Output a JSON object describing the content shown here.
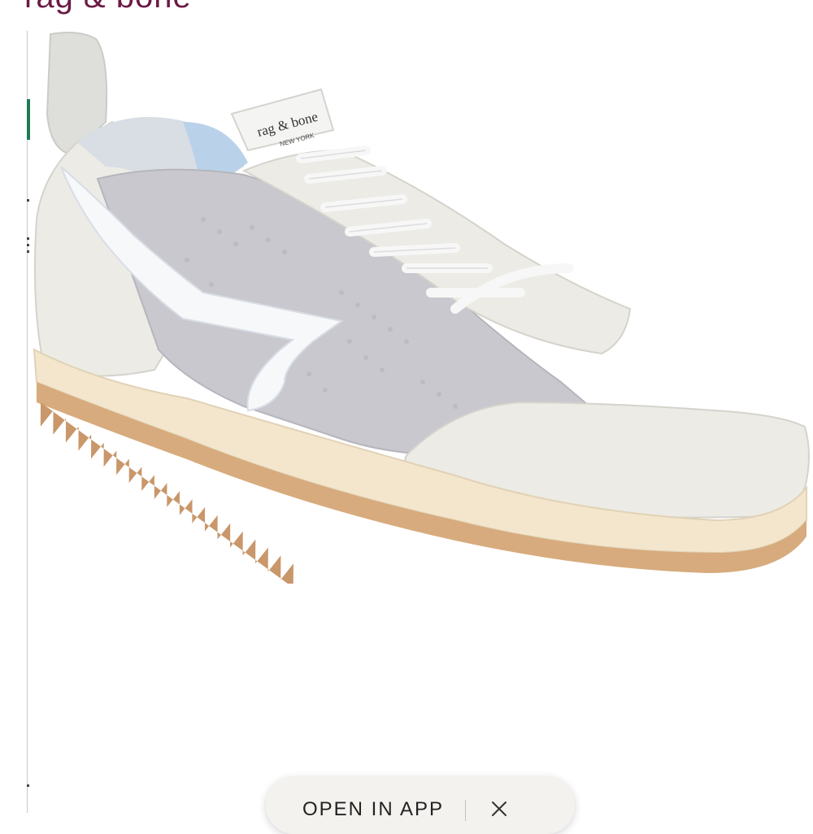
{
  "header": {
    "title": "rag & bone"
  },
  "product_image": {
    "alt": "rag & bone retro runner sneaker in grey mesh and suede",
    "tongue_label_brand": "rag & bone",
    "tongue_label_city": "NEW YORK"
  },
  "banner": {
    "open_in_app_label": "OPEN IN APP",
    "close_icon": "close-icon"
  }
}
